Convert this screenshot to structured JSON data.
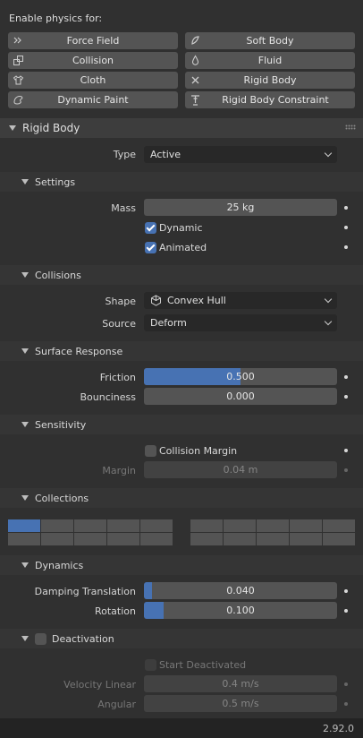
{
  "enable_physics": {
    "heading": "Enable physics for:",
    "buttons": [
      {
        "label": "Force Field",
        "icon": "force-field-icon"
      },
      {
        "label": "Soft Body",
        "icon": "soft-body-icon"
      },
      {
        "label": "Collision",
        "icon": "collision-icon"
      },
      {
        "label": "Fluid",
        "icon": "fluid-icon"
      },
      {
        "label": "Cloth",
        "icon": "cloth-icon"
      },
      {
        "label": "Rigid Body",
        "icon": "close-icon"
      },
      {
        "label": "Dynamic Paint",
        "icon": "dynamic-paint-icon"
      },
      {
        "label": "Rigid Body Constraint",
        "icon": "rigid-body-constraint-icon"
      }
    ]
  },
  "rigid_body": {
    "title": "Rigid Body",
    "type_label": "Type",
    "type_value": "Active",
    "settings": {
      "title": "Settings",
      "mass_label": "Mass",
      "mass_value": "25 kg",
      "dynamic_label": "Dynamic",
      "dynamic_checked": true,
      "animated_label": "Animated",
      "animated_checked": true
    },
    "collisions": {
      "title": "Collisions",
      "shape_label": "Shape",
      "shape_value": "Convex Hull",
      "source_label": "Source",
      "source_value": "Deform"
    },
    "surface_response": {
      "title": "Surface Response",
      "friction_label": "Friction",
      "friction_value": "0.500",
      "friction_fraction": 0.5,
      "bounciness_label": "Bounciness",
      "bounciness_value": "0.000"
    },
    "sensitivity": {
      "title": "Sensitivity",
      "collision_margin_label": "Collision Margin",
      "collision_margin_checked": false,
      "margin_label": "Margin",
      "margin_value": "0.04 m"
    },
    "collections": {
      "title": "Collections",
      "selected_layer": 0
    },
    "dynamics": {
      "title": "Dynamics",
      "damping_translation_label": "Damping Translation",
      "damping_translation_value": "0.040",
      "damping_translation_fraction": 0.04,
      "rotation_label": "Rotation",
      "rotation_value": "0.100",
      "rotation_fraction": 0.1
    },
    "deactivation": {
      "title": "Deactivation",
      "enabled": false,
      "start_deactivated_label": "Start Deactivated",
      "velocity_linear_label": "Velocity Linear",
      "velocity_linear_value": "0.4 m/s",
      "angular_label": "Angular",
      "angular_value": "0.5 m/s"
    }
  },
  "footer": {
    "version": "2.92.0"
  },
  "colors": {
    "accent": "#4772b3",
    "panel_bg": "#303030",
    "field_bg": "#545454"
  }
}
